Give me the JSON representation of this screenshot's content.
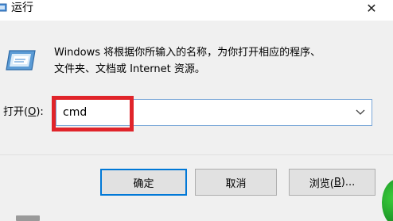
{
  "window": {
    "title": "运行",
    "close_glyph": "✕"
  },
  "icons": {
    "title_icon": "run-app-icon",
    "dialog_icon": "run-dialog-icon",
    "close_icon": "close-icon",
    "dropdown_icon": "chevron-down-icon"
  },
  "description": {
    "line1": "Windows 将根据你所输入的名称，为你打开相应的程序、",
    "line2": "文件夹、文档或 Internet 资源。"
  },
  "open_field": {
    "label_prefix": "打开(",
    "label_accel": "O",
    "label_suffix": "):",
    "value": "cmd"
  },
  "buttons": {
    "ok": "确定",
    "cancel": "取消",
    "browse_prefix": "浏览(",
    "browse_accel": "B",
    "browse_suffix": ")..."
  },
  "colors": {
    "highlight": "#e0242a",
    "focus_border": "#0078d7",
    "input_border": "#7aa7d8"
  }
}
